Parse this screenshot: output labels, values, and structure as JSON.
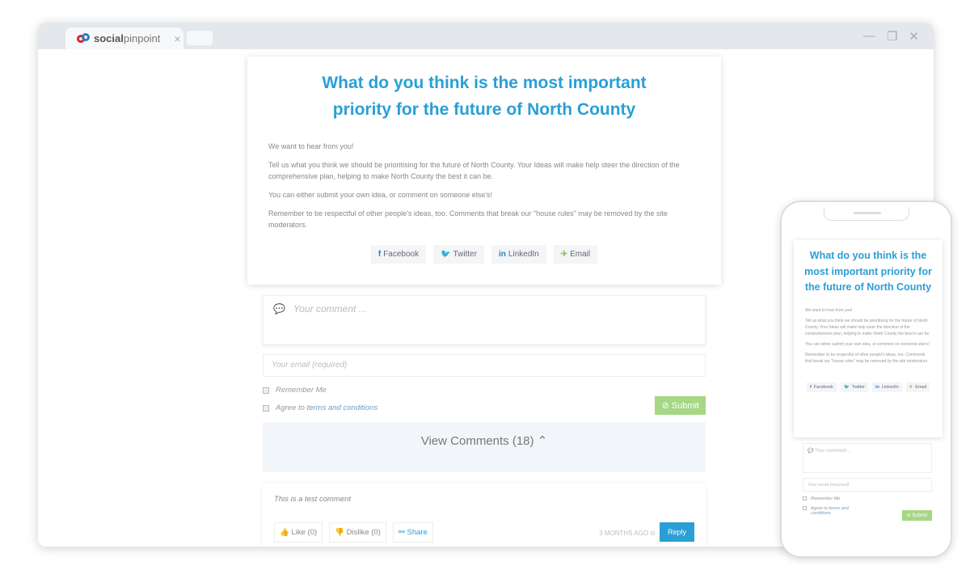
{
  "browser": {
    "tab_brand_bold": "social",
    "tab_brand_light": "pinpoint",
    "tab_close": "×",
    "controls": {
      "minimize": "—",
      "restore": "❐",
      "close": "✕"
    }
  },
  "page": {
    "title": "What do you think is the most important priority for the future of North County",
    "paragraphs": [
      "We want to hear from you!",
      "Tell us what you think we should be prioritising for the future of North County. Your Ideas will make help steer the direction of the comprehensive plan, helping to make North County the best it can be.",
      "You can either submit your own idea, or comment on someone else's!",
      "Remember to be respectful of other people's ideas, too. Comments that break our \"house rules\" may be removed by the site moderators."
    ],
    "share": [
      {
        "icon": "f",
        "label": "Facebook"
      },
      {
        "icon": "🐦",
        "label": "Twitter"
      },
      {
        "icon": "in",
        "label": "LinkedIn"
      },
      {
        "icon": "✈",
        "label": "Email"
      }
    ]
  },
  "form": {
    "comment_placeholder": "Your comment ...",
    "email_placeholder": "Your email (required)",
    "remember": "Remember Me",
    "agree_prefix": "Agree to ",
    "agree_link": "terms and conditions",
    "submit": "Submit"
  },
  "comments": {
    "view_label": "View Comments (18)",
    "chevron": "⌃",
    "items": [
      {
        "text": "This is a test comment",
        "like": "Like (0)",
        "dislike": "Dislike (0)",
        "share": "Share",
        "ago": "3 MONTHS AGO",
        "reply": "Reply"
      }
    ]
  },
  "phone_title": "What do you think is the most important priority for the future of North County"
}
